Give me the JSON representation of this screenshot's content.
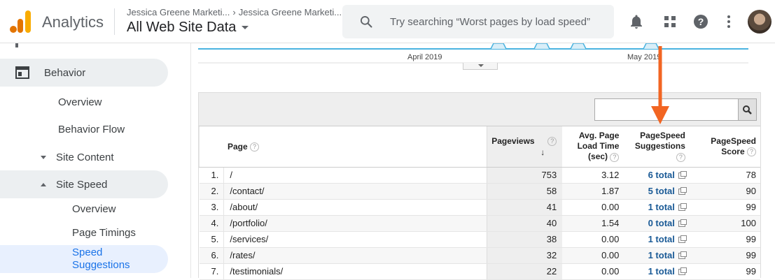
{
  "header": {
    "app_title": "Analytics",
    "breadcrumb_account": "Jessica Greene Marketi...",
    "breadcrumb_property": "Jessica Greene Marketi...",
    "view_title": "All Web Site Data",
    "search_placeholder": "Try searching “Worst pages by load speed”"
  },
  "sidebar": {
    "behavior": "Behavior",
    "overview": "Overview",
    "behavior_flow": "Behavior Flow",
    "site_content": "Site Content",
    "site_speed": "Site Speed",
    "speed_overview": "Overview",
    "page_timings": "Page Timings",
    "speed_suggestions": "Speed Suggestions"
  },
  "chart": {
    "label_april": "April 2019",
    "label_may": "May 2019"
  },
  "table": {
    "headers": {
      "page": "Page",
      "pageviews": "Pageviews",
      "load_time_1": "Avg. Page",
      "load_time_2": "Load Time",
      "load_time_3": "(sec)",
      "suggestions_1": "PageSpeed",
      "suggestions_2": "Suggestions",
      "score_1": "PageSpeed",
      "score_2": "Score"
    },
    "rows": [
      {
        "num": "1.",
        "page": "/",
        "pageviews": "753",
        "load_time": "3.12",
        "suggestions": "6 total",
        "score": "78"
      },
      {
        "num": "2.",
        "page": "/contact/",
        "pageviews": "58",
        "load_time": "1.87",
        "suggestions": "5 total",
        "score": "90"
      },
      {
        "num": "3.",
        "page": "/about/",
        "pageviews": "41",
        "load_time": "0.00",
        "suggestions": "1 total",
        "score": "99"
      },
      {
        "num": "4.",
        "page": "/portfolio/",
        "pageviews": "40",
        "load_time": "1.54",
        "suggestions": "0 total",
        "score": "100"
      },
      {
        "num": "5.",
        "page": "/services/",
        "pageviews": "38",
        "load_time": "0.00",
        "suggestions": "1 total",
        "score": "99"
      },
      {
        "num": "6.",
        "page": "/rates/",
        "pageviews": "32",
        "load_time": "0.00",
        "suggestions": "1 total",
        "score": "99"
      },
      {
        "num": "7.",
        "page": "/testimonials/",
        "pageviews": "22",
        "load_time": "0.00",
        "suggestions": "1 total",
        "score": "99"
      }
    ]
  },
  "colors": {
    "accent_blue": "#1a73e8",
    "link_blue": "#1a5a96",
    "arrow_orange": "#f26522",
    "chart_line": "#4ab3e0"
  },
  "icons": [
    "search-icon",
    "notifications-icon",
    "apps-grid-icon",
    "help-icon",
    "more-vert-icon",
    "behavior-icon",
    "external-link-icon",
    "sort-desc-icon",
    "help-circle-icon"
  ]
}
